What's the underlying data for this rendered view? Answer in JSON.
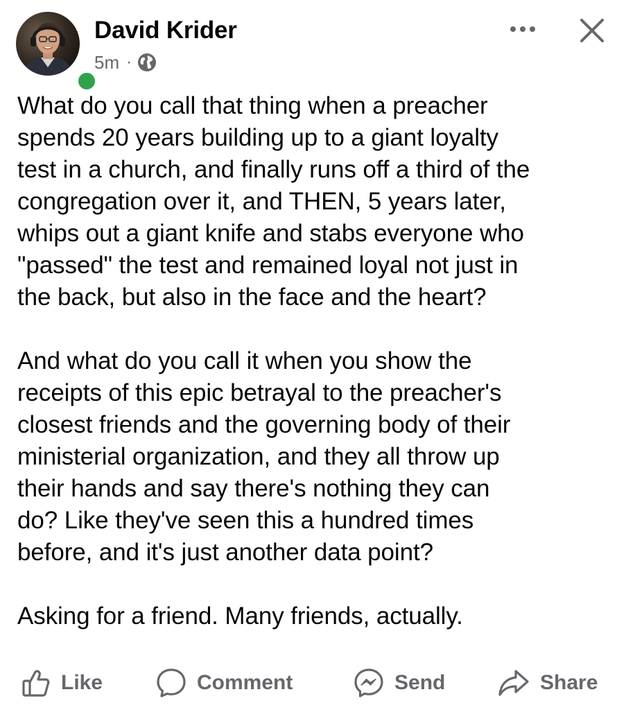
{
  "post": {
    "author": "David Krider",
    "timestamp": "5m",
    "separator": "·",
    "audience_icon": "globe-icon",
    "paragraphs": [
      "What do you call that thing when a preacher\nspends 20 years building up to a giant loyalty\ntest in a church, and finally runs off a third of the\ncongregation over it, and THEN, 5 years later,\nwhips out a giant knife and stabs everyone who\n\"passed\" the test and remained loyal not just in\nthe back, but also in the face and the heart?",
      "And what do you call it when you show the\nreceipts of this epic betrayal to the preacher's\nclosest friends and the governing body of their\nministerial organization, and they all throw up\ntheir hands and say there's nothing they can\ndo? Like they've seen this a hundred times\nbefore, and it's just another data point?",
      "Asking for a friend. Many friends, actually."
    ]
  },
  "header": {
    "more_icon": "more-horizontal-icon",
    "close_icon": "close-icon",
    "online_status": "online"
  },
  "actions": {
    "like": "Like",
    "comment": "Comment",
    "send": "Send",
    "share": "Share"
  },
  "colors": {
    "text_primary": "#050505",
    "text_secondary": "#65676b",
    "online_green": "#31a24c",
    "background": "#ffffff"
  }
}
